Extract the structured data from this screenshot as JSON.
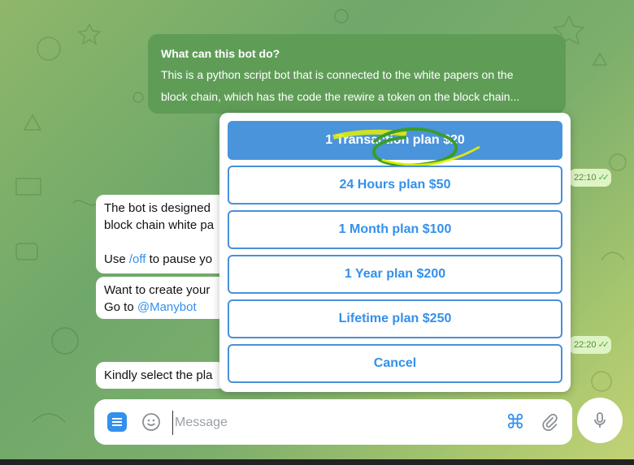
{
  "info_bubble": {
    "question": "What can this bot do?",
    "description_line1": "This is a python script bot that is connected to the white papers on the",
    "description_line2": "block chain, which has the code the rewire a token on the block chain..."
  },
  "chat": {
    "time1": "22:10",
    "time2": "22:20",
    "msg1_line1": "The bot is designed",
    "msg1_line2": "block chain white pa",
    "msg1_use": "Use ",
    "msg1_cmd": "/off",
    "msg1_rest": " to pause yo",
    "msg2_line1": "Want to create your",
    "msg2_goto": "Go to ",
    "msg2_link": "@Manybot",
    "msg3": "Kindly select the pla"
  },
  "plans": [
    {
      "label": "1 Transaction plan $20"
    },
    {
      "label": "24 Hours plan $50"
    },
    {
      "label": "1 Month plan $100"
    },
    {
      "label": "1 Year plan $200"
    },
    {
      "label": "Lifetime plan $250"
    },
    {
      "label": "Cancel"
    }
  ],
  "composer": {
    "placeholder": "Message"
  },
  "colors": {
    "accent": "#3390ec",
    "highlight": "#e8f000",
    "scribble": "#3a9d2a"
  },
  "icons": [
    "menu-icon",
    "emoji-icon",
    "command-icon",
    "attach-icon",
    "mic-icon",
    "double-check-icon"
  ]
}
